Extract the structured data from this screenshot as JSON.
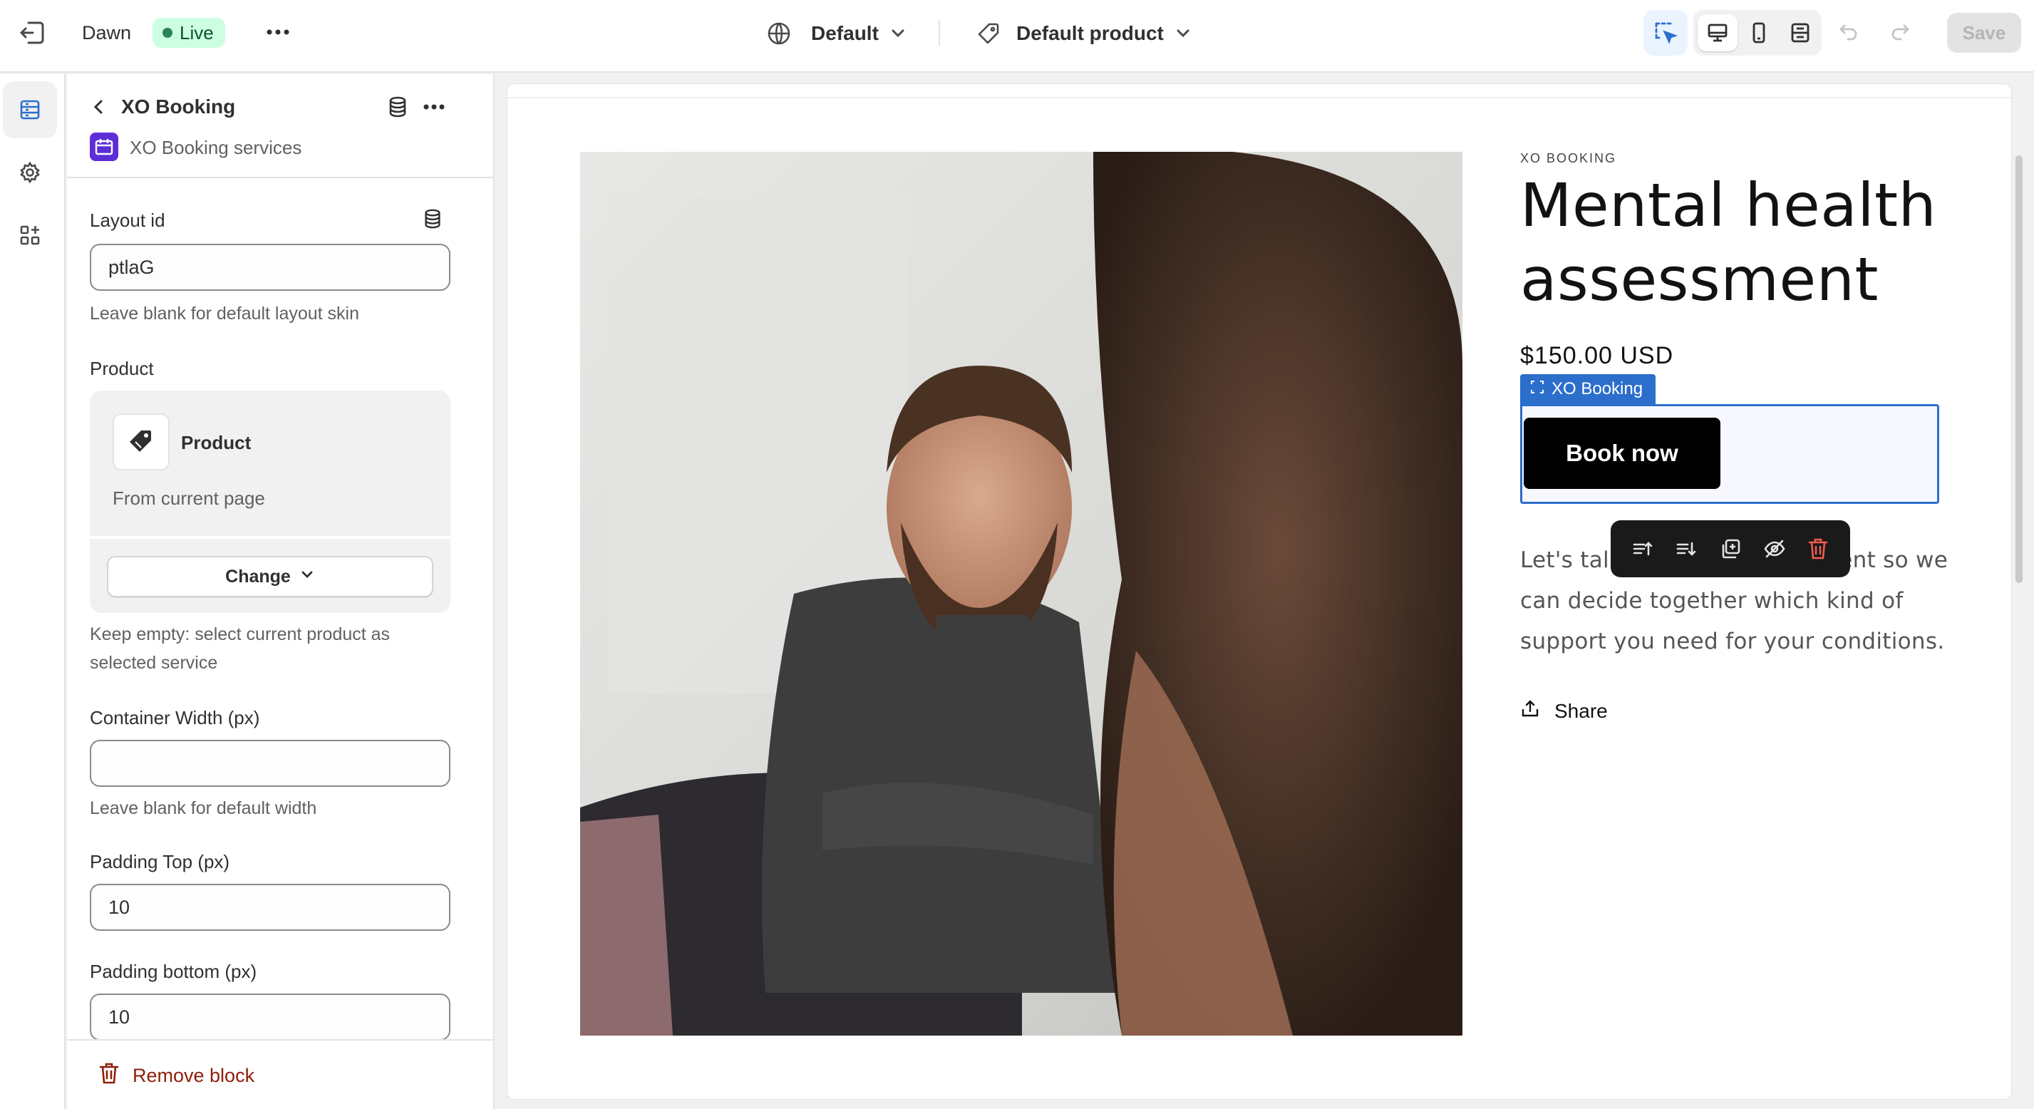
{
  "topbar": {
    "exit_icon": "exit-icon",
    "theme_name": "Dawn",
    "status": "Live",
    "more_icon": "more-horizontal-icon",
    "template_selector": "Default",
    "product_selector": "Default product",
    "save_label": "Save",
    "viewports": [
      "desktop",
      "mobile",
      "full-width"
    ]
  },
  "rail": {
    "items": [
      "sections-icon",
      "settings-icon",
      "apps-icon"
    ]
  },
  "panel": {
    "title": "XO Booking",
    "app_name": "XO Booking services",
    "fields": {
      "layout_id": {
        "label": "Layout id",
        "value": "ptlaG",
        "help": "Leave blank for default layout skin"
      },
      "product": {
        "label": "Product",
        "name": "Product",
        "source": "From current page",
        "change_label": "Change",
        "help": "Keep empty: select current product as selected service"
      },
      "container_width": {
        "label": "Container Width (px)",
        "value": "",
        "help": "Leave blank for default width"
      },
      "padding_top": {
        "label": "Padding Top (px)",
        "value": "10"
      },
      "padding_bottom": {
        "label": "Padding bottom (px)",
        "value": "10"
      }
    },
    "remove_label": "Remove block"
  },
  "preview": {
    "vendor": "XO BOOKING",
    "title": "Mental health assessment",
    "price": "$150.00 USD",
    "block_tag": "XO Booking",
    "book_label": "Book now",
    "description": "Let's talk in a safe environment so we can decide together which kind of support you need for your conditions.",
    "share_label": "Share",
    "toolbar_icons": [
      "move-up-icon",
      "move-down-icon",
      "duplicate-icon",
      "hide-icon",
      "delete-icon"
    ]
  },
  "colors": {
    "accent": "#2c6ecb",
    "live_bg": "#cdfee1",
    "live_dot": "#29845a",
    "danger": "#8e1f0b",
    "app_icon": "#5c2fd6"
  }
}
